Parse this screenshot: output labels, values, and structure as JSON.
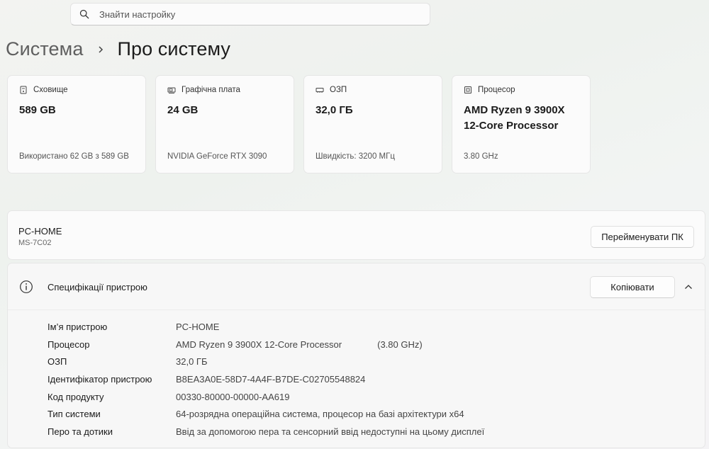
{
  "search": {
    "placeholder": "Знайти настройку",
    "icon": "search-icon"
  },
  "breadcrumb": {
    "parent": "Система",
    "current": "Про систему"
  },
  "cards": [
    {
      "caption": "Сховище",
      "value_line1": "589 GB",
      "value_line2": "",
      "subtext": "Використано 62 GB з 589 GB",
      "icon": "storage-icon"
    },
    {
      "caption": "Графічна плата",
      "value_line1": "24 GB",
      "value_line2": "",
      "subtext": "NVIDIA GeForce RTX 3090",
      "icon": "gpu-icon"
    },
    {
      "caption": "ОЗП",
      "value_line1": "32,0 ГБ",
      "value_line2": "",
      "subtext": "Швидкість: 3200 МГц",
      "icon": "ram-icon"
    },
    {
      "caption": "Процесор",
      "value_line1": "AMD Ryzen 9 3900X",
      "value_line2": "12-Core Processor",
      "subtext": "3.80 GHz",
      "icon": "cpu-icon"
    }
  ],
  "pc": {
    "name": "PC-HOME",
    "model": "MS-7C02",
    "rename_label": "Перейменувати ПК"
  },
  "specs": {
    "title": "Специфікації пристрою",
    "copy_label": "Копіювати",
    "rows": [
      {
        "key": "Ім’я пристрою",
        "value": "PC-HOME",
        "extra": ""
      },
      {
        "key": "Процесор",
        "value": "AMD Ryzen 9 3900X 12-Core Processor",
        "extra": "(3.80 GHz)"
      },
      {
        "key": "ОЗП",
        "value": "32,0 ГБ",
        "extra": ""
      },
      {
        "key": "Ідентифікатор пристрою",
        "value": "B8EA3A0E-58D7-4A4F-B7DE-C02705548824",
        "extra": ""
      },
      {
        "key": "Код продукту",
        "value": "00330-80000-00000-AA619",
        "extra": ""
      },
      {
        "key": "Тип системи",
        "value": "64-розрядна операційна система, процесор на базі архітектури x64",
        "extra": ""
      },
      {
        "key": "Перо та дотики",
        "value": "Ввід за допомогою пера та сенсорний ввід недоступні на цьому дисплеї",
        "extra": ""
      }
    ]
  }
}
